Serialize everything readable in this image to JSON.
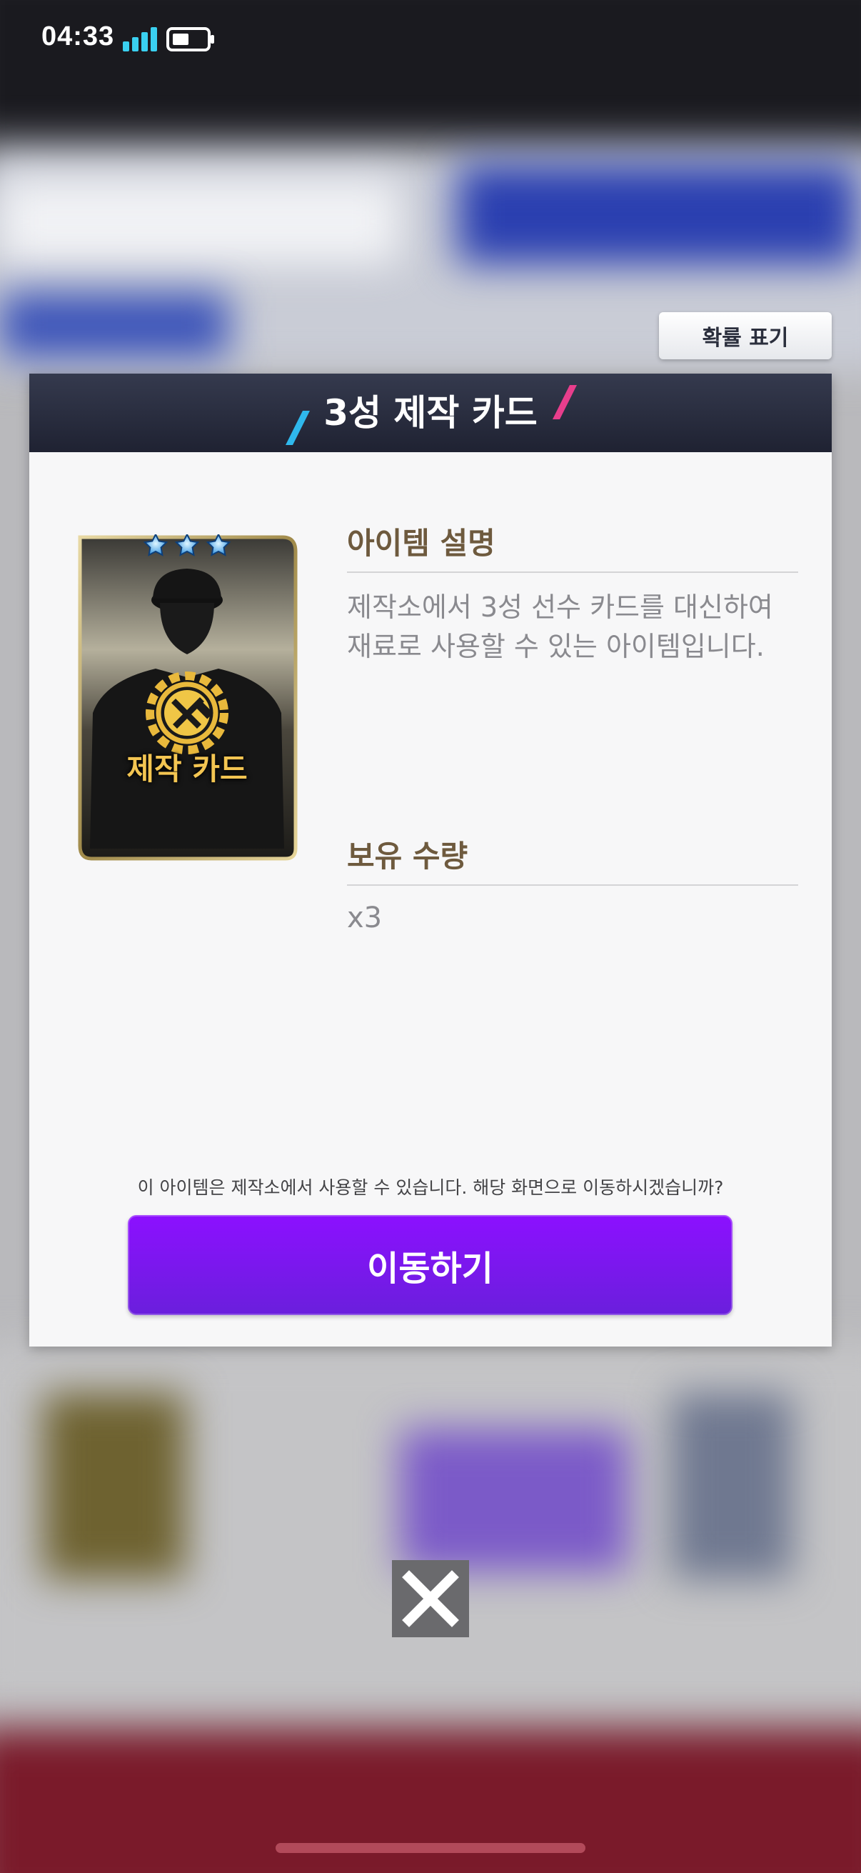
{
  "status_bar": {
    "time": "04:33"
  },
  "header_actions": {
    "probability_label": "확률 표기"
  },
  "modal": {
    "title": "3성 제작 카드",
    "card_label": "제작 카드",
    "card_stars": 3,
    "description_heading": "아이템 설명",
    "description_lines": [
      "제작소에서 3성 선수 카드를 대신하여",
      "재료로 사용할 수 있는 아이템입니다."
    ],
    "quantity_heading": "보유 수량",
    "quantity_value": "x3",
    "notice": "이 아이템은 제작소에서 사용할 수 있습니다. 해당 화면으로 이동하시겠습니까?",
    "move_button_label": "이동하기"
  },
  "icons": {
    "signal": "signal-bars-icon",
    "battery": "battery-icon",
    "close": "close-icon",
    "star": "star-icon",
    "craft": "hammer-gear-icon"
  },
  "colors": {
    "header_bg": "#262a3c",
    "accent_blue": "#2fb8ec",
    "accent_pink": "#e83e8c",
    "button_purple": "#7a16f0",
    "heading_brown": "#6e5a3e",
    "signal_cyan": "#3ad0f0"
  }
}
